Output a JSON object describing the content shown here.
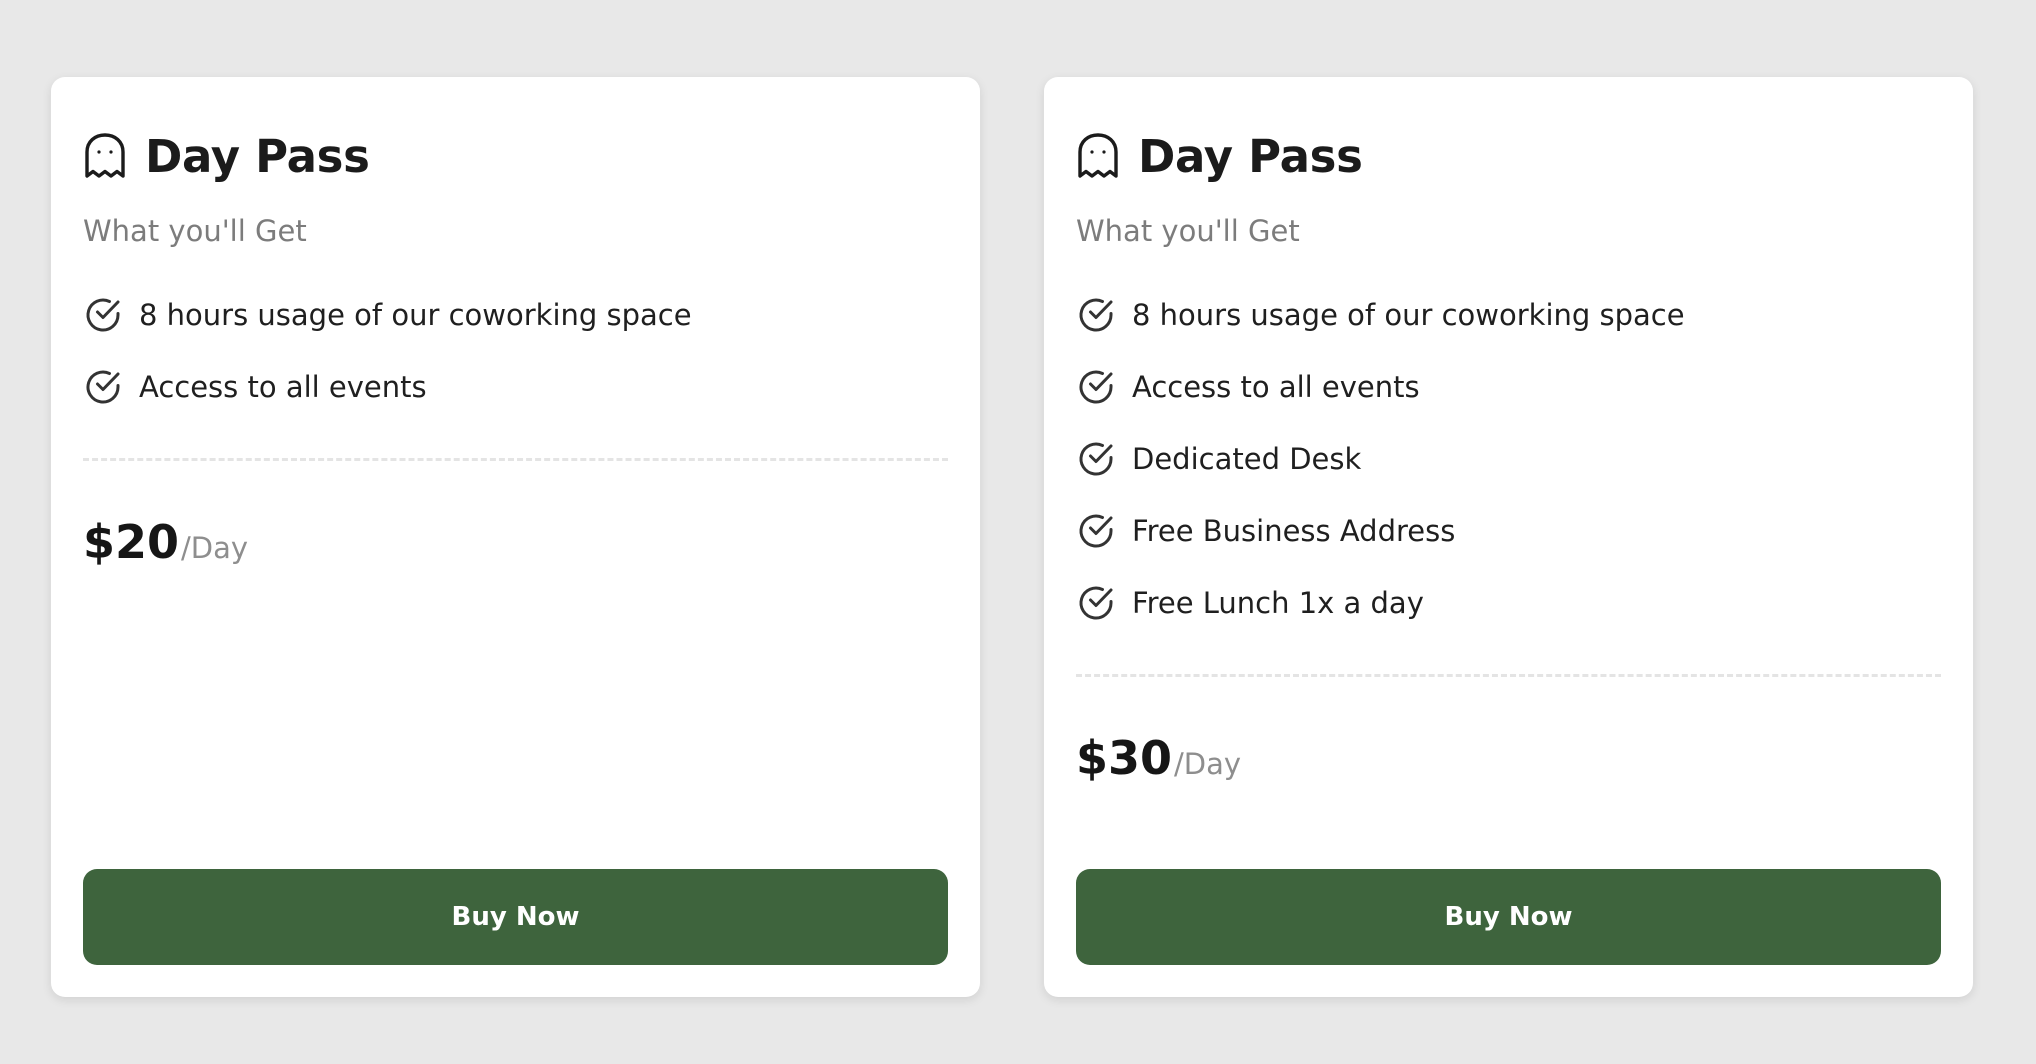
{
  "colors": {
    "background": "#e8e8e8",
    "card": "#ffffff",
    "button": "#3e643d",
    "button_text": "#ffffff",
    "subtitle": "#7c7c7c",
    "period": "#8e8e8e",
    "divider": "#e4e4e4"
  },
  "cards": [
    {
      "icon": "ghost-icon",
      "title": "Day Pass",
      "subtitle": "What you'll Get",
      "features": [
        "8 hours usage of our coworking space",
        "Access to all events"
      ],
      "price": "$20",
      "period": "/Day",
      "button_label": "Buy Now"
    },
    {
      "icon": "ghost-icon",
      "title": "Day Pass",
      "subtitle": "What you'll Get",
      "features": [
        "8 hours usage of our coworking space",
        "Access to all events",
        "Dedicated Desk",
        "Free Business Address",
        "Free Lunch 1x a day"
      ],
      "price": "$30",
      "period": "/Day",
      "button_label": "Buy Now"
    }
  ]
}
